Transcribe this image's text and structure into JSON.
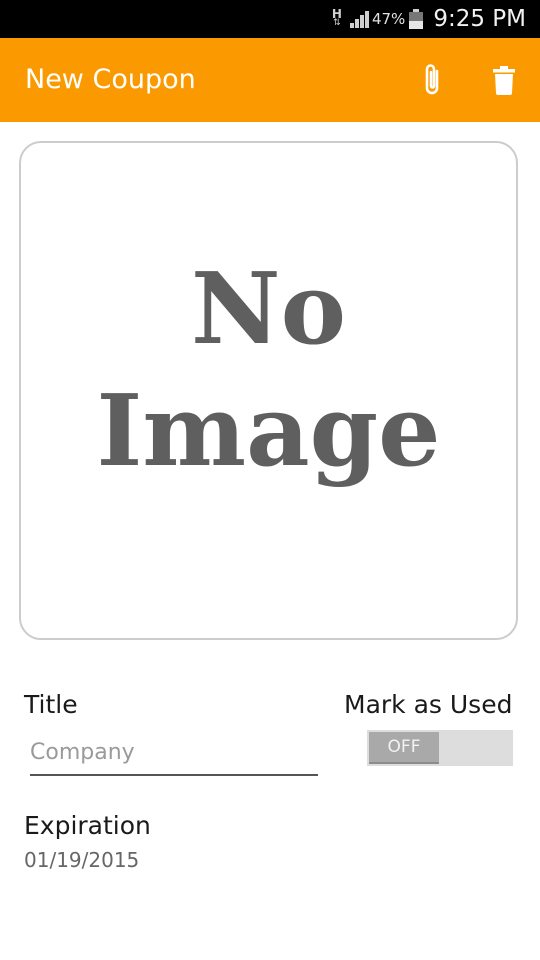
{
  "status_bar": {
    "network_type": "H",
    "network_arrows": "⇅",
    "battery_percent": "47%",
    "battery_level": 0.47,
    "time": "9:25 PM",
    "icons": [
      "network-type-icon",
      "signal-icon",
      "battery-icon"
    ]
  },
  "app_bar": {
    "title": "New Coupon",
    "background": "#fa9a00",
    "actions": [
      {
        "name": "attach",
        "icon": "paperclip-icon"
      },
      {
        "name": "delete",
        "icon": "trash-icon"
      }
    ]
  },
  "image_placeholder": {
    "line1": "No",
    "line2": "Image"
  },
  "form": {
    "title_label": "Title",
    "title_placeholder": "Company",
    "title_value": "",
    "used_label": "Mark as Used",
    "used_toggle_text": "OFF",
    "used_toggle_state": "off",
    "expiration_label": "Expiration",
    "expiration_value": "01/19/2015"
  }
}
